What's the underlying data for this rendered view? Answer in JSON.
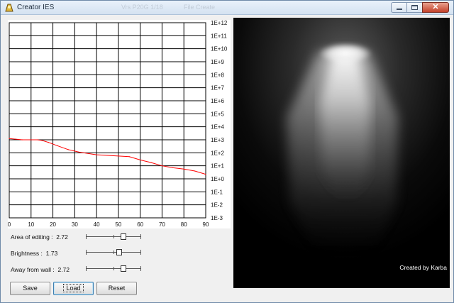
{
  "window": {
    "title": "Creator IES",
    "ghost_texts": [
      "Vrs P20G 1/18",
      "File Create"
    ]
  },
  "chart_data": {
    "type": "line",
    "title": "",
    "xlabel": "",
    "ylabel": "",
    "x_ticks": [
      "0",
      "10",
      "20",
      "30",
      "40",
      "50",
      "60",
      "70",
      "80",
      "90"
    ],
    "y_ticks": [
      "1E+12",
      "1E+11",
      "1E+10",
      "1E+9",
      "1E+8",
      "1E+7",
      "1E+6",
      "1E+5",
      "1E+4",
      "1E+3",
      "1E+2",
      "1E+1",
      "1E+0",
      "1E-1",
      "1E-2",
      "1E-3"
    ],
    "xlim": [
      0,
      90
    ],
    "ylim_log10": [
      -3,
      12
    ],
    "y_scale": "log",
    "grid": true,
    "series": [
      {
        "color": "#ff0000",
        "x": [
          0,
          3,
          6,
          13,
          15,
          18,
          22,
          27,
          32,
          40,
          50,
          55,
          60,
          65,
          70,
          75,
          80,
          85,
          90
        ],
        "log10_y": [
          3.1,
          3.05,
          3.0,
          3.0,
          2.95,
          2.8,
          2.55,
          2.25,
          2.05,
          1.85,
          1.75,
          1.7,
          1.45,
          1.25,
          1.0,
          0.85,
          0.75,
          0.6,
          0.35
        ]
      }
    ]
  },
  "controls": [
    {
      "label": "Area of editing :",
      "value": "2.72",
      "slider_position": 0.68
    },
    {
      "label": "Brightness :",
      "value": "1.73",
      "slider_position": 0.6
    },
    {
      "label": "Away from wall :",
      "value": "2.72",
      "slider_position": 0.68
    }
  ],
  "buttons": {
    "save": "Save",
    "load": "Load",
    "reset": "Reset"
  },
  "preview": {
    "credit": "Created by Karba"
  }
}
